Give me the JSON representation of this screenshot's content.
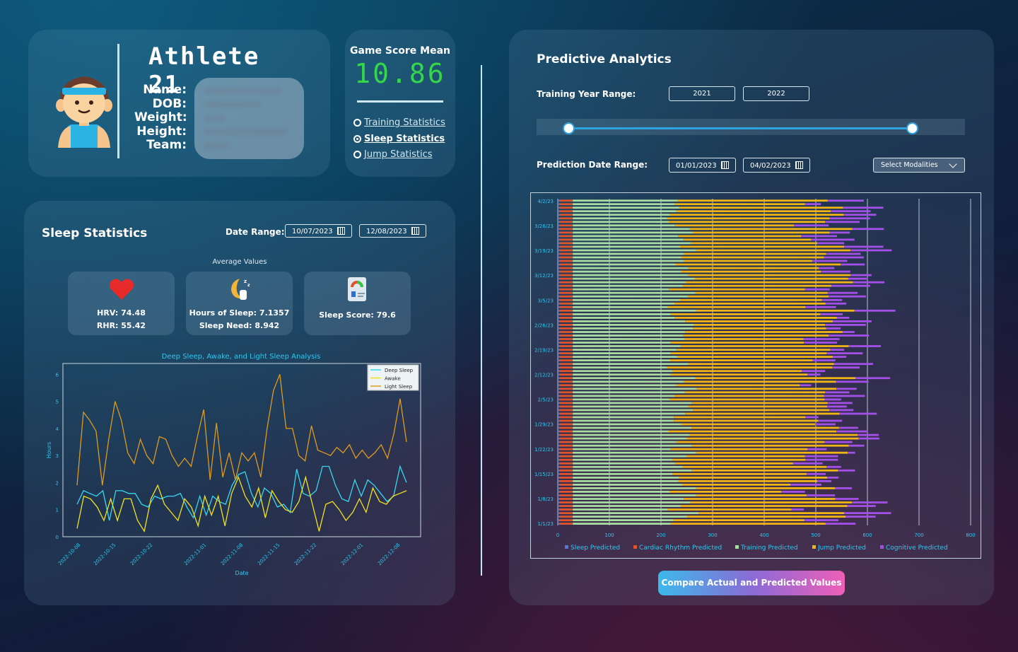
{
  "athlete": {
    "title": "Athlete 21",
    "labels": [
      "Name:",
      "DOB:",
      "Weight:",
      "Height:",
      "Team:"
    ],
    "avatar_icon": "athlete-avatar-icon"
  },
  "score": {
    "title": "Game Score Mean",
    "value": "10.86",
    "options": [
      {
        "label": "Training Statistics",
        "selected": false
      },
      {
        "label": "Sleep Statistics",
        "selected": true
      },
      {
        "label": "Jump Statistics",
        "selected": false
      }
    ]
  },
  "sleep": {
    "title": "Sleep Statistics",
    "range_label": "Date Range:",
    "start_date": "10/07/2023",
    "end_date": "12/08/2023",
    "avg_title": "Average Values",
    "tiles": [
      {
        "icon": "heart-icon",
        "lines": [
          "HRV:  74.48",
          "RHR:  55.42"
        ]
      },
      {
        "icon": "moon-sleep-icon",
        "lines": [
          "Hours of Sleep: 7.1357",
          "Sleep Need: 8.942"
        ]
      },
      {
        "icon": "score-report-icon",
        "lines": [
          "Sleep Score: 79.6"
        ]
      }
    ]
  },
  "pred": {
    "title": "Predictive Analytics",
    "year_label": "Training Year Range:",
    "year_start": "2021",
    "year_end": "2022",
    "date_label": "Prediction Date Range:",
    "date_start": "01/01/2023",
    "date_end": "04/02/2023",
    "modalities": "Select Modalities",
    "button": "Compare Actual and Predicted Values"
  },
  "colors": {
    "deep": "#35d8f0",
    "awake": "#f2e21e",
    "light": "#e09a1c",
    "sleep_pred": "#5a74d8",
    "cardiac": "#e0542c",
    "training": "#a8dca0",
    "jump": "#f0b414",
    "cognitive": "#a250e8"
  },
  "chart_data": [
    {
      "type": "line",
      "title": "Deep Sleep, Awake, and Light Sleep Analysis",
      "xlabel": "Date",
      "ylabel": "Hours",
      "ylim": [
        0,
        6.4
      ],
      "yticks": [
        "0",
        "1",
        "2",
        "3",
        "4",
        "5",
        "6"
      ],
      "xticks": [
        "2022-10-08",
        "2022-10-15",
        "2022-10-22",
        "2022-11-01",
        "2022-11-08",
        "2022-11-15",
        "2022-11-22",
        "2022-12-01",
        "2022-12-08"
      ],
      "legend": "top-right",
      "series": [
        {
          "name": "Deep Sleep",
          "values": [
            1.2,
            1.7,
            1.6,
            1.5,
            1.7,
            0.6,
            1.7,
            1.7,
            1.6,
            1.6,
            1.2,
            1.1,
            1.5,
            1.4,
            1.5,
            1.5,
            1.6,
            1.1,
            0.7,
            1.5,
            0.8,
            1.5,
            1.3,
            1.2,
            1.9,
            2.3,
            2.4,
            1.6,
            1.1,
            1.8,
            1.6,
            1.1,
            1.2,
            0.9,
            2.5,
            1.6,
            1.5,
            1.7,
            2.6,
            2.6,
            1.9,
            1.4,
            1.3,
            2.1,
            1.5,
            2.1,
            1.9,
            1.6,
            1.3,
            1.5,
            2.6,
            2.0
          ]
        },
        {
          "name": "Awake",
          "values": [
            0.3,
            1.5,
            1.4,
            1.1,
            0.6,
            1.4,
            0.6,
            1.4,
            1.4,
            0.6,
            0.2,
            1.4,
            1.9,
            1.2,
            0.9,
            0.6,
            1.4,
            1.1,
            0.4,
            1.5,
            0.8,
            1.5,
            0.4,
            1.6,
            2.2,
            1.5,
            1.1,
            1.8,
            0.7,
            1.7,
            1.3,
            1.0,
            0.9,
            1.3,
            2.2,
            1.2,
            0.2,
            1.2,
            1.3,
            1.0,
            0.6,
            0.9,
            1.4,
            0.9,
            1.8,
            1.3,
            1.2,
            1.5,
            1.6,
            1.7
          ]
        },
        {
          "name": "Light Sleep",
          "values": [
            1.9,
            4.6,
            4.3,
            3.9,
            1.9,
            3.6,
            5.0,
            4.3,
            3.1,
            2.7,
            3.6,
            3.0,
            2.7,
            3.7,
            3.6,
            3.0,
            2.6,
            2.9,
            2.6,
            3.7,
            4.7,
            2.1,
            4.2,
            2.2,
            3.1,
            2.1,
            3.1,
            2.8,
            3.1,
            2.2,
            4.0,
            5.4,
            6.0,
            4.0,
            4.0,
            3.0,
            2.8,
            4.1,
            3.2,
            3.1,
            3.0,
            3.3,
            3.1,
            3.4,
            2.9,
            3.2,
            2.9,
            3.1,
            3.4,
            2.9,
            3.8,
            5.1,
            3.5
          ]
        }
      ]
    },
    {
      "type": "bar",
      "stacked": true,
      "orientation": "horizontal",
      "xlim": [
        0,
        800
      ],
      "xticks": [
        "0",
        "100",
        "200",
        "300",
        "400",
        "500",
        "600",
        "700",
        "800"
      ],
      "yticks": [
        "1/1/23",
        "1/8/23",
        "1/15/23",
        "1/22/23",
        "1/29/23",
        "2/5/23",
        "2/12/23",
        "2/19/23",
        "2/26/23",
        "3/5/23",
        "3/12/23",
        "3/19/23",
        "3/26/23",
        "4/2/23"
      ],
      "legend": "bottom",
      "series_names": [
        "Sleep Predicted",
        "Cardiac Rhythm Predicted",
        "Training Predicted",
        "Jump Predicted",
        "Cognitive Predicted"
      ],
      "series": [
        {
          "name": "Sleep Predicted",
          "values": [
            3,
            3,
            3,
            3,
            3,
            3,
            3,
            3,
            3,
            3,
            3,
            3,
            3,
            3,
            3,
            3,
            3,
            3,
            3,
            3,
            3,
            3,
            3,
            3,
            3,
            3,
            3,
            3,
            3,
            3,
            3,
            3,
            3,
            3,
            3,
            3,
            3,
            3,
            3,
            3,
            3,
            3,
            3,
            3,
            3,
            3,
            3,
            3,
            3,
            3,
            3,
            3,
            3,
            3,
            3,
            3,
            3,
            3,
            3,
            3,
            3,
            3,
            3,
            3,
            3,
            3,
            3,
            3,
            3,
            3,
            3,
            3,
            3,
            3,
            3,
            3,
            3,
            3,
            3,
            3,
            3,
            3,
            3,
            3,
            3,
            3,
            3,
            3,
            3,
            3,
            3,
            3
          ]
        },
        {
          "name": "Cardiac Rhythm Predicted",
          "values": [
            26,
            26,
            26,
            26,
            26,
            26,
            26,
            26,
            26,
            26,
            26,
            26,
            26,
            26,
            26,
            26,
            26,
            26,
            26,
            26,
            26,
            26,
            26,
            26,
            26,
            26,
            26,
            26,
            26,
            26,
            26,
            26,
            26,
            26,
            26,
            26,
            26,
            26,
            26,
            26,
            26,
            26,
            26,
            26,
            26,
            26,
            26,
            26,
            26,
            26,
            26,
            26,
            26,
            26,
            26,
            26,
            26,
            26,
            26,
            26,
            26,
            26,
            26,
            26,
            26,
            26,
            26,
            26,
            26,
            26,
            26,
            26,
            26,
            26,
            26,
            26,
            26,
            26,
            26,
            26,
            26,
            26,
            26,
            26,
            26,
            26,
            26,
            26,
            26,
            26,
            26,
            26,
            26
          ]
        },
        {
          "name": "Training Predicted",
          "values": [
            190,
            195,
            222,
            244,
            184,
            209,
            228,
            215,
            239,
            188,
            239,
            212,
            205,
            206,
            193,
            231,
            212,
            198,
            194,
            221,
            239,
            190,
            231,
            201,
            221,
            227,
            186,
            230,
            210,
            196,
            196,
            218,
            233,
            223,
            231,
            188,
            197,
            217,
            240,
            201,
            216,
            238,
            190,
            194,
            182,
            223,
            189,
            203,
            190,
            201,
            209,
            190,
            217,
            214,
            218,
            233,
            234,
            218,
            198,
            190,
            239,
            184,
            197,
            208,
            224,
            238,
            187,
            214,
            219,
            236,
            224,
            210,
            223,
            199,
            216,
            210,
            216,
            239,
            208,
            229,
            215,
            204,
            232,
            227,
            198,
            186,
            182,
            188,
            201,
            207,
            198,
            203
          ]
        },
        {
          "name": "Jump Predicted",
          "values": [
            300,
            254,
            307,
            282,
            240,
            323,
            313,
            294,
            214,
            216,
            269,
            210,
            269,
            287,
            260,
            283,
            280,
            229,
            257,
            229,
            294,
            265,
            304,
            287,
            333,
            325,
            325,
            286,
            260,
            280,
            255,
            299,
            264,
            270,
            263,
            300,
            290,
            272,
            271,
            239,
            294,
            310,
            265,
            250,
            321,
            283,
            276,
            301,
            302,
            298,
            326,
            258,
            230,
            282,
            305,
            258,
            255,
            286,
            314,
            290,
            307,
            267,
            293,
            275,
            272,
            256,
            263,
            287,
            324,
            298,
            314,
            271,
            254,
            320,
            248,
            277,
            275,
            299,
            318,
            245,
            247,
            239,
            266,
            315,
            231,
            303,
            316,
            337,
            299,
            317,
            252,
            291
          ]
        },
        {
          "name": "Cognitive Predicted",
          "values": [
            58,
            66,
            58,
            91,
            24,
            55,
            69,
            45,
            55,
            46,
            33,
            60,
            27,
            22,
            37,
            33,
            28,
            57,
            63,
            64,
            14,
            37,
            30,
            54,
            40,
            41,
            61,
            37,
            39,
            46,
            25,
            72,
            47,
            38,
            48,
            32,
            79,
            47,
            39,
            22,
            63,
            67,
            25,
            45,
            53,
            76,
            44,
            26,
            70,
            27,
            62,
            64,
            70,
            78,
            23,
            28,
            79,
            75,
            24,
            43,
            79,
            59,
            40,
            39,
            72,
            58,
            48,
            75,
            61,
            38,
            41,
            57,
            30,
            47,
            68,
            77,
            67,
            80,
            76,
            52,
            84,
            69,
            39,
            61,
            67,
            67,
            78,
            63,
            77,
            78,
            31,
            70
          ]
        }
      ]
    }
  ]
}
